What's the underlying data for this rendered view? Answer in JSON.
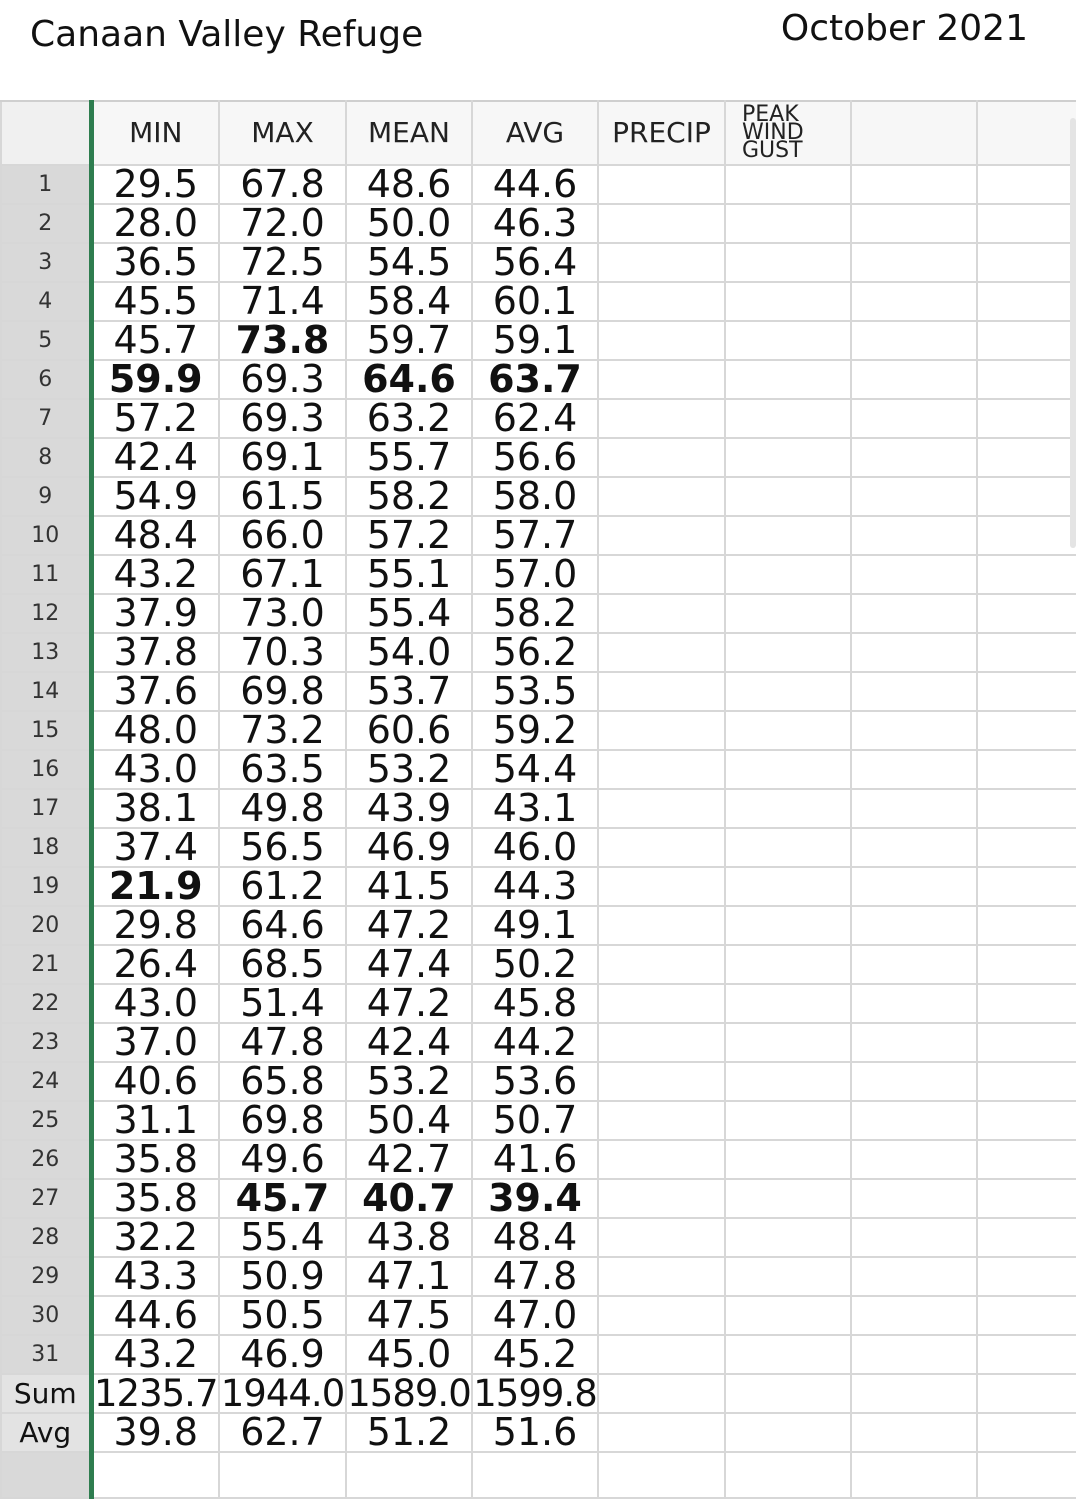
{
  "header": {
    "title": "Canaan Valley Refuge",
    "month": "October 2021"
  },
  "columns": {
    "min": "MIN",
    "max": "MAX",
    "mean": "MEAN",
    "avg": "AVG",
    "precip": "PRECIP",
    "wind": "PEAK WIND GUST"
  },
  "rows": [
    {
      "day": "1",
      "min": "29.5",
      "max": "67.8",
      "mean": "48.6",
      "avg": "44.6"
    },
    {
      "day": "2",
      "min": "28.0",
      "max": "72.0",
      "mean": "50.0",
      "avg": "46.3"
    },
    {
      "day": "3",
      "min": "36.5",
      "max": "72.5",
      "mean": "54.5",
      "avg": "56.4"
    },
    {
      "day": "4",
      "min": "45.5",
      "max": "71.4",
      "mean": "58.4",
      "avg": "60.1"
    },
    {
      "day": "5",
      "min": "45.7",
      "max": "73.8",
      "mean": "59.7",
      "avg": "59.1"
    },
    {
      "day": "6",
      "min": "59.9",
      "max": "69.3",
      "mean": "64.6",
      "avg": "63.7"
    },
    {
      "day": "7",
      "min": "57.2",
      "max": "69.3",
      "mean": "63.2",
      "avg": "62.4"
    },
    {
      "day": "8",
      "min": "42.4",
      "max": "69.1",
      "mean": "55.7",
      "avg": "56.6"
    },
    {
      "day": "9",
      "min": "54.9",
      "max": "61.5",
      "mean": "58.2",
      "avg": "58.0"
    },
    {
      "day": "10",
      "min": "48.4",
      "max": "66.0",
      "mean": "57.2",
      "avg": "57.7"
    },
    {
      "day": "11",
      "min": "43.2",
      "max": "67.1",
      "mean": "55.1",
      "avg": "57.0"
    },
    {
      "day": "12",
      "min": "37.9",
      "max": "73.0",
      "mean": "55.4",
      "avg": "58.2"
    },
    {
      "day": "13",
      "min": "37.8",
      "max": "70.3",
      "mean": "54.0",
      "avg": "56.2"
    },
    {
      "day": "14",
      "min": "37.6",
      "max": "69.8",
      "mean": "53.7",
      "avg": "53.5"
    },
    {
      "day": "15",
      "min": "48.0",
      "max": "73.2",
      "mean": "60.6",
      "avg": "59.2"
    },
    {
      "day": "16",
      "min": "43.0",
      "max": "63.5",
      "mean": "53.2",
      "avg": "54.4"
    },
    {
      "day": "17",
      "min": "38.1",
      "max": "49.8",
      "mean": "43.9",
      "avg": "43.1"
    },
    {
      "day": "18",
      "min": "37.4",
      "max": "56.5",
      "mean": "46.9",
      "avg": "46.0"
    },
    {
      "day": "19",
      "min": "21.9",
      "max": "61.2",
      "mean": "41.5",
      "avg": "44.3"
    },
    {
      "day": "20",
      "min": "29.8",
      "max": "64.6",
      "mean": "47.2",
      "avg": "49.1"
    },
    {
      "day": "21",
      "min": "26.4",
      "max": "68.5",
      "mean": "47.4",
      "avg": "50.2"
    },
    {
      "day": "22",
      "min": "43.0",
      "max": "51.4",
      "mean": "47.2",
      "avg": "45.8"
    },
    {
      "day": "23",
      "min": "37.0",
      "max": "47.8",
      "mean": "42.4",
      "avg": "44.2"
    },
    {
      "day": "24",
      "min": "40.6",
      "max": "65.8",
      "mean": "53.2",
      "avg": "53.6"
    },
    {
      "day": "25",
      "min": "31.1",
      "max": "69.8",
      "mean": "50.4",
      "avg": "50.7"
    },
    {
      "day": "26",
      "min": "35.8",
      "max": "49.6",
      "mean": "42.7",
      "avg": "41.6"
    },
    {
      "day": "27",
      "min": "35.8",
      "max": "45.7",
      "mean": "40.7",
      "avg": "39.4"
    },
    {
      "day": "28",
      "min": "32.2",
      "max": "55.4",
      "mean": "43.8",
      "avg": "48.4"
    },
    {
      "day": "29",
      "min": "43.3",
      "max": "50.9",
      "mean": "47.1",
      "avg": "47.8"
    },
    {
      "day": "30",
      "min": "44.6",
      "max": "50.5",
      "mean": "47.5",
      "avg": "47.0"
    },
    {
      "day": "31",
      "min": "43.2",
      "max": "46.9",
      "mean": "45.0",
      "avg": "45.2"
    }
  ],
  "sum": {
    "label": "Sum",
    "min": "1235.7",
    "max": "1944.0",
    "mean": "1589.0",
    "avg": "1599.8"
  },
  "average": {
    "label": "Avg",
    "min": "39.8",
    "max": "62.7",
    "mean": "51.2",
    "avg": "51.6"
  },
  "colors": {
    "hot": "#a8141a",
    "cold": "#2a7fd0",
    "coldest": "#1e88e5",
    "freeze_pane": "#2e7d4f"
  }
}
